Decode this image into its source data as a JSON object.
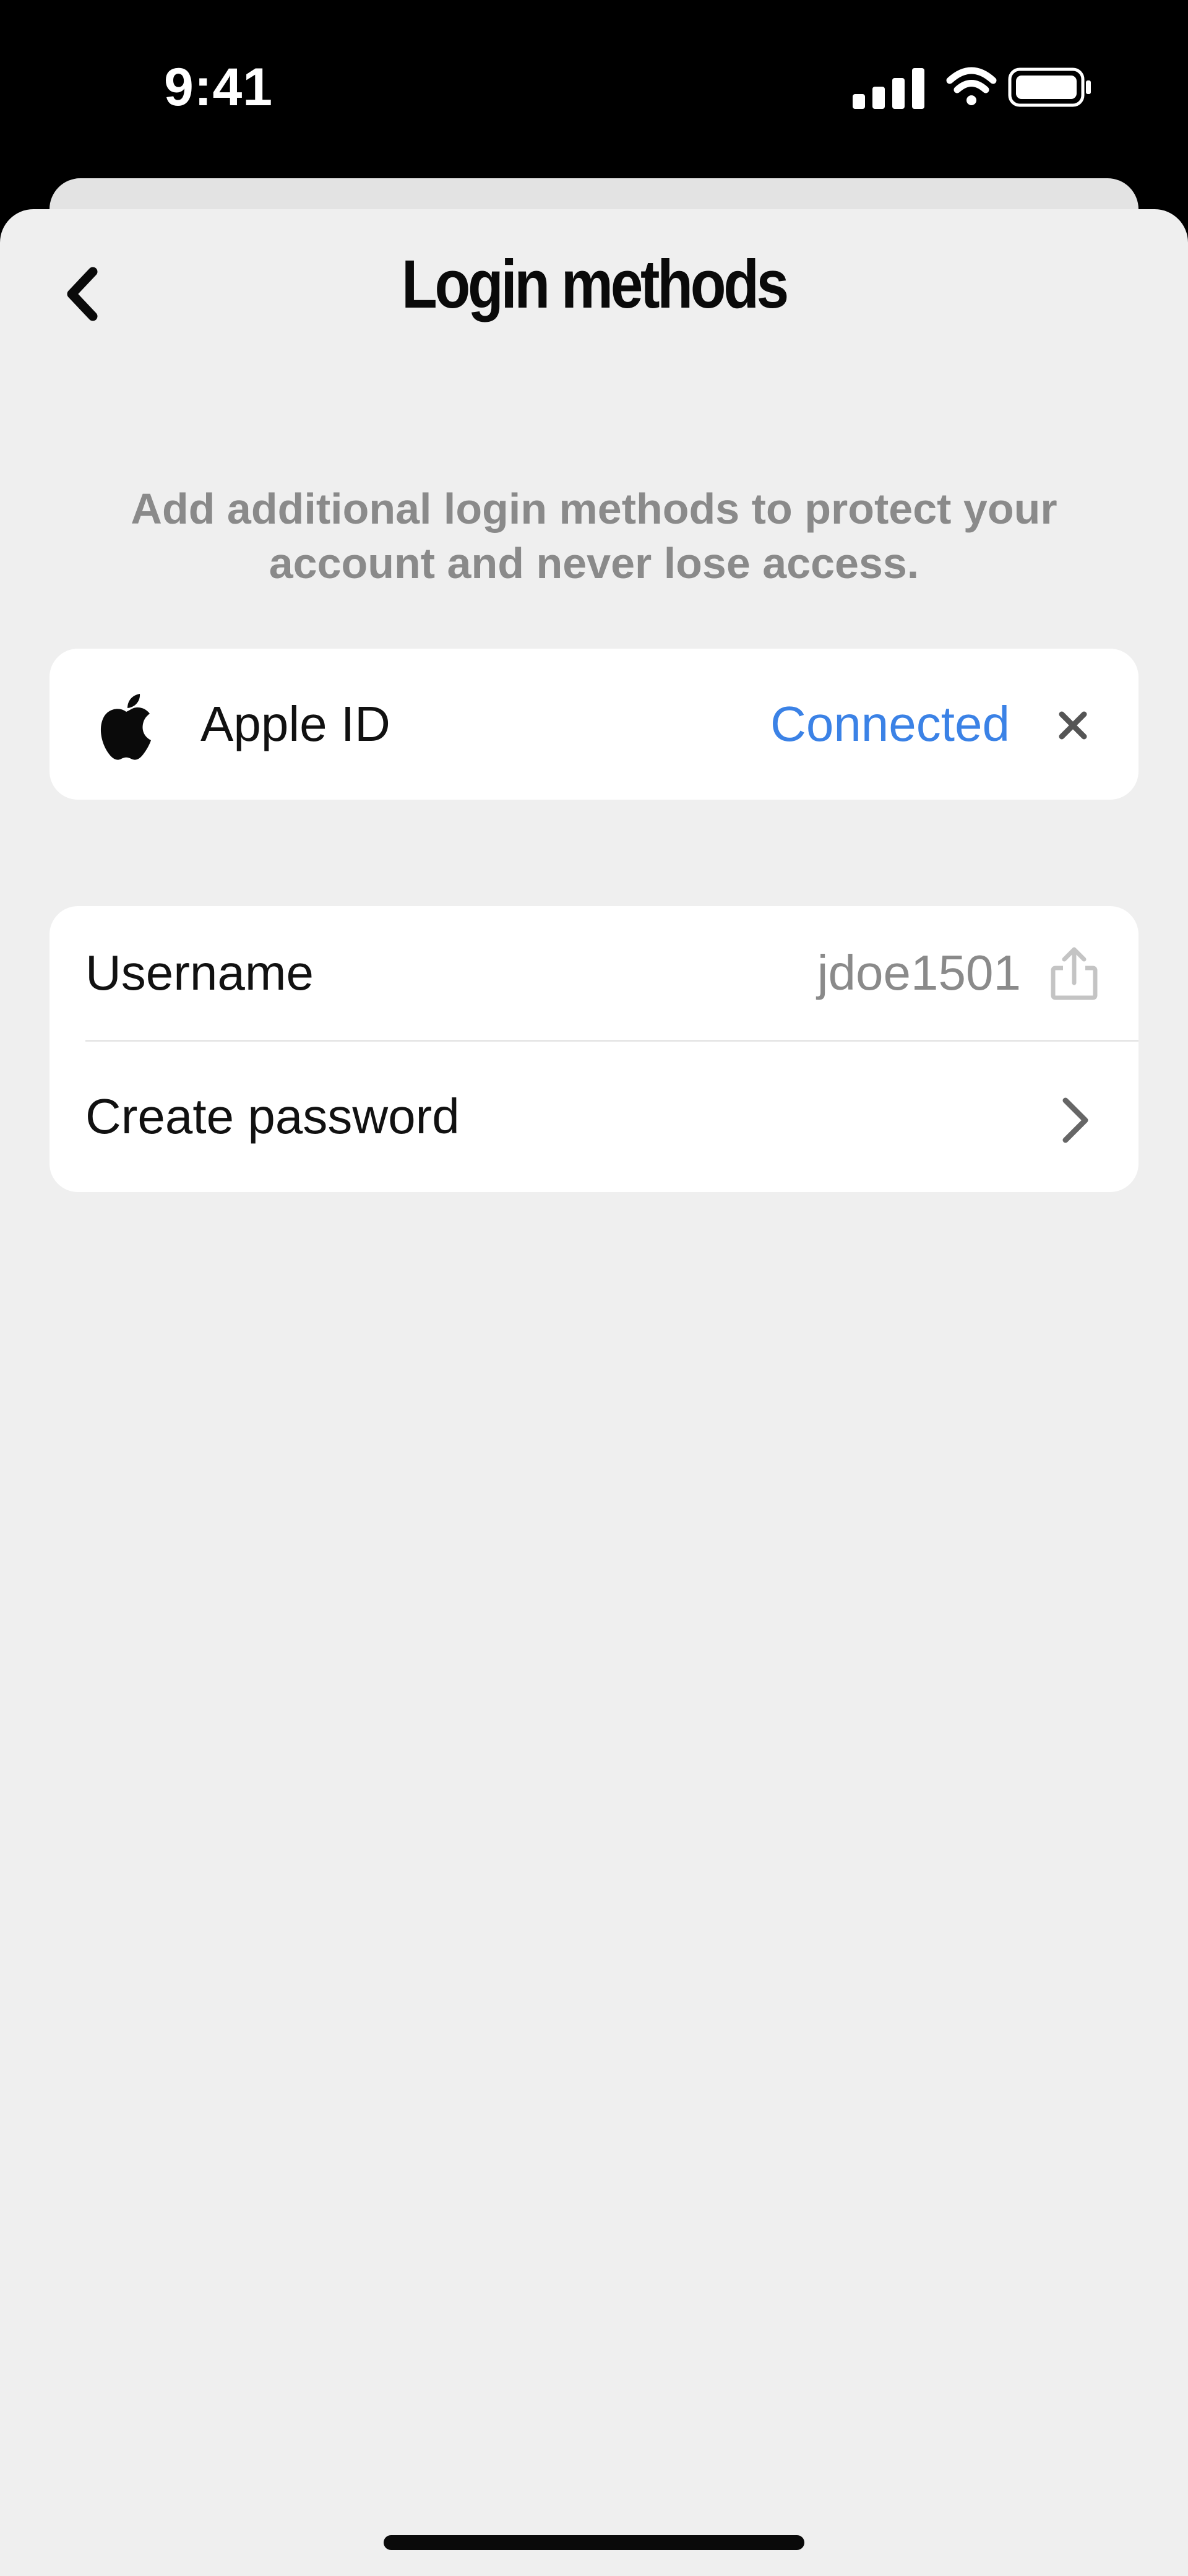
{
  "status_bar": {
    "time": "9:41",
    "icons": [
      "cellular-signal-icon",
      "wifi-icon",
      "battery-icon"
    ]
  },
  "header": {
    "title": "Login methods",
    "back_icon": "chevron-left-icon"
  },
  "description": "Add additional login methods to protect your account and never lose access.",
  "apple_row": {
    "icon": "apple-logo-icon",
    "label": "Apple ID",
    "status": "Connected",
    "remove_icon": "close-icon"
  },
  "account": {
    "username_label": "Username",
    "username_value": "jdoe1501",
    "share_icon": "share-icon",
    "password_label": "Create password",
    "password_icon": "chevron-right-icon"
  },
  "colors": {
    "accent": "#3b82e6",
    "background": "#efefef",
    "card": "#ffffff",
    "muted_text": "#8a8a8a"
  }
}
